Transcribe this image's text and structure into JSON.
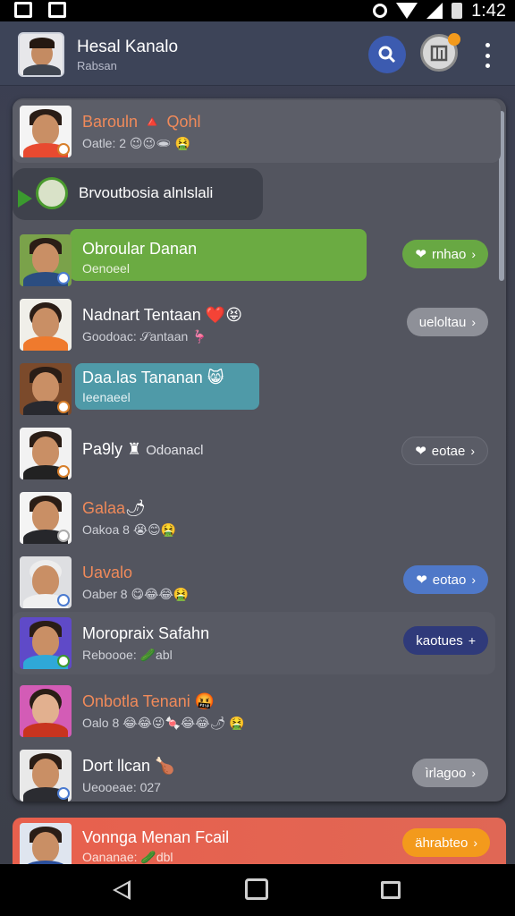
{
  "status_bar": {
    "time": "1:42"
  },
  "header": {
    "title": "Hesal Kanalo",
    "subtitle": "Rabsan"
  },
  "group": {
    "label": "Brvoutbosia alnlslali"
  },
  "chats": [
    {
      "name": "Barouln",
      "name_extra": "🔺 Qohl",
      "name_color": "#f08a5a",
      "sub": "Oatle: 2",
      "emojis": "😉😉🕳 🤮"
    },
    {
      "name": "Obroular Danan",
      "sub": "Oenoeel",
      "action": "rnhao"
    },
    {
      "name": "Nadnart Tentaan",
      "name_extra": "❤️😝",
      "sub": "Goodoac:",
      "sub_extra": "𝒮antaan 🦩",
      "action": "ueloltau"
    },
    {
      "name": "Daa.las Tananan",
      "name_extra": "😸",
      "sub": "Ieenaeel"
    },
    {
      "name": "Pa9ly",
      "name_extra": "♜",
      "sub_inline": "Odoanacl",
      "action": "eotae"
    },
    {
      "name": "Galaa",
      "name_extra": "🌶",
      "name_color": "#f08a5a",
      "sub": "Oakoa 8",
      "emojis": "😭😊🤮"
    },
    {
      "name": "Uavalo",
      "name_color": "#f08a5a",
      "sub": "Oaber 8",
      "emojis": "😋😂😂🤮",
      "action": "eotao"
    },
    {
      "name": "Moropraix Safahn",
      "sub": "Reboooe:",
      "sub_extra": "🥒abl",
      "action": "kaotues"
    },
    {
      "name": "Onbotla Tenani",
      "name_extra": "🤬",
      "name_color": "#f08a5a",
      "sub": "Oalo 8",
      "emojis": "😂😂😜🍬😂😂🌶 🤮"
    },
    {
      "name": "Dort llcan",
      "name_extra": "🍗",
      "sub": "Ueooeae: 027",
      "action": "ìrlagoo"
    }
  ],
  "promo": {
    "name": "Vonnga Menan Fcail",
    "sub": "Oananae:",
    "sub_extra": "🥒dbl",
    "action": "ährabteo"
  },
  "colors": {
    "accent_blue": "#3c5bb0",
    "green": "#68a843",
    "teal": "#4f9aa8",
    "navy": "#2f3a7a",
    "orange": "#f39a1c"
  }
}
